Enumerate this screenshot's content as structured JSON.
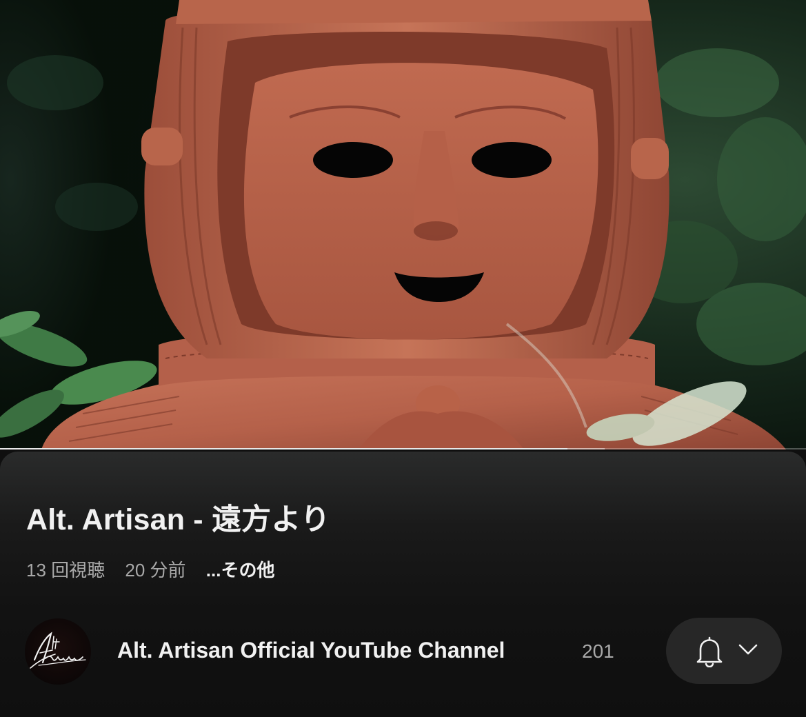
{
  "video": {
    "title": "Alt. Artisan - 遠方より",
    "progress_fraction": 0.704,
    "buffered_fraction": 0.75
  },
  "meta": {
    "views": "13 回視聴",
    "uploaded": "20 分前",
    "more": "...その他"
  },
  "channel": {
    "name": "Alt. Artisan Official YouTube Channel",
    "subscriber_count": "201",
    "avatar_logo_text": "Alt. Artisan"
  },
  "subscribe_control": {
    "bell_icon": "bell-icon",
    "chevron_icon": "chevron-down-icon"
  },
  "colors": {
    "background": "#0f0f0f",
    "text_primary": "#f1f1f1",
    "text_secondary": "#a9a9a9",
    "pill": "#272727"
  }
}
